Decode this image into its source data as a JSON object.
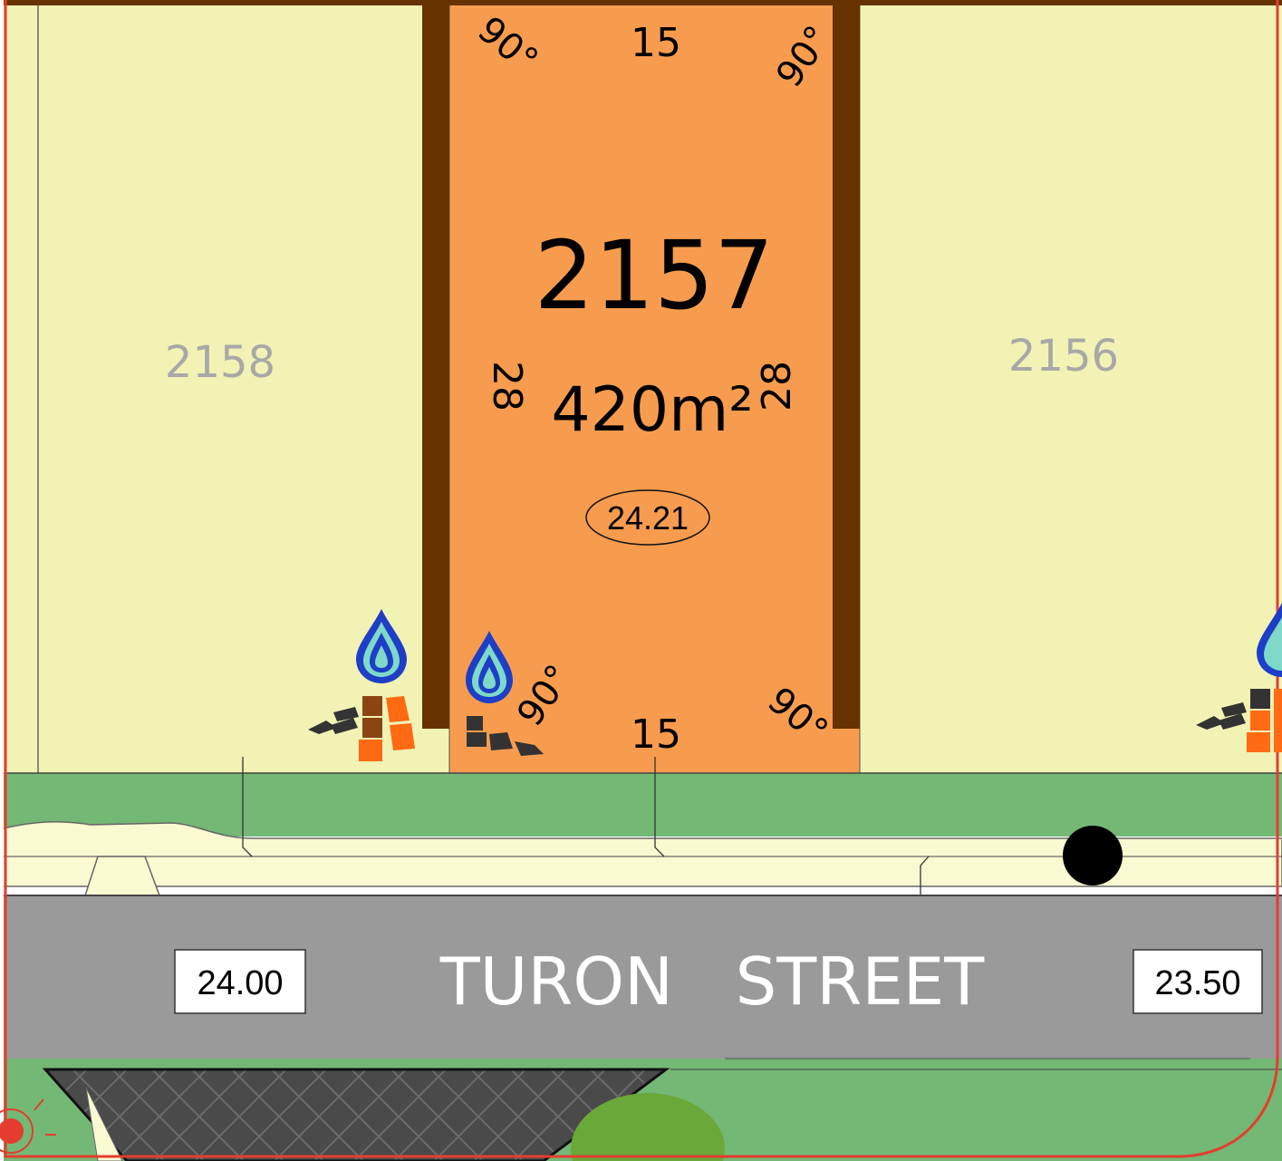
{
  "lots": {
    "main": {
      "number": "2157",
      "area": "420m²",
      "level": "24.21",
      "frontage_top": "15",
      "frontage_bottom": "15",
      "depth_left": "28",
      "depth_right": "28",
      "angle_label": "90°"
    },
    "left": {
      "number": "2158"
    },
    "right": {
      "number": "2156"
    }
  },
  "street": {
    "name": "TURON   STREET",
    "level_left": "24.00",
    "level_right": "23.50"
  },
  "colors": {
    "main_lot": "#f79c4e",
    "adjacent_lot": "#f2f2b4",
    "verge": "#74b875",
    "road": "#9a9a9a",
    "retaining_wall": "#663300",
    "footpath": "#fafad2",
    "border": "#e43d2f"
  },
  "icons": [
    "water-drop-icon",
    "brick-paver-icon",
    "street-tree-icon",
    "sewer-manhole-icon"
  ]
}
